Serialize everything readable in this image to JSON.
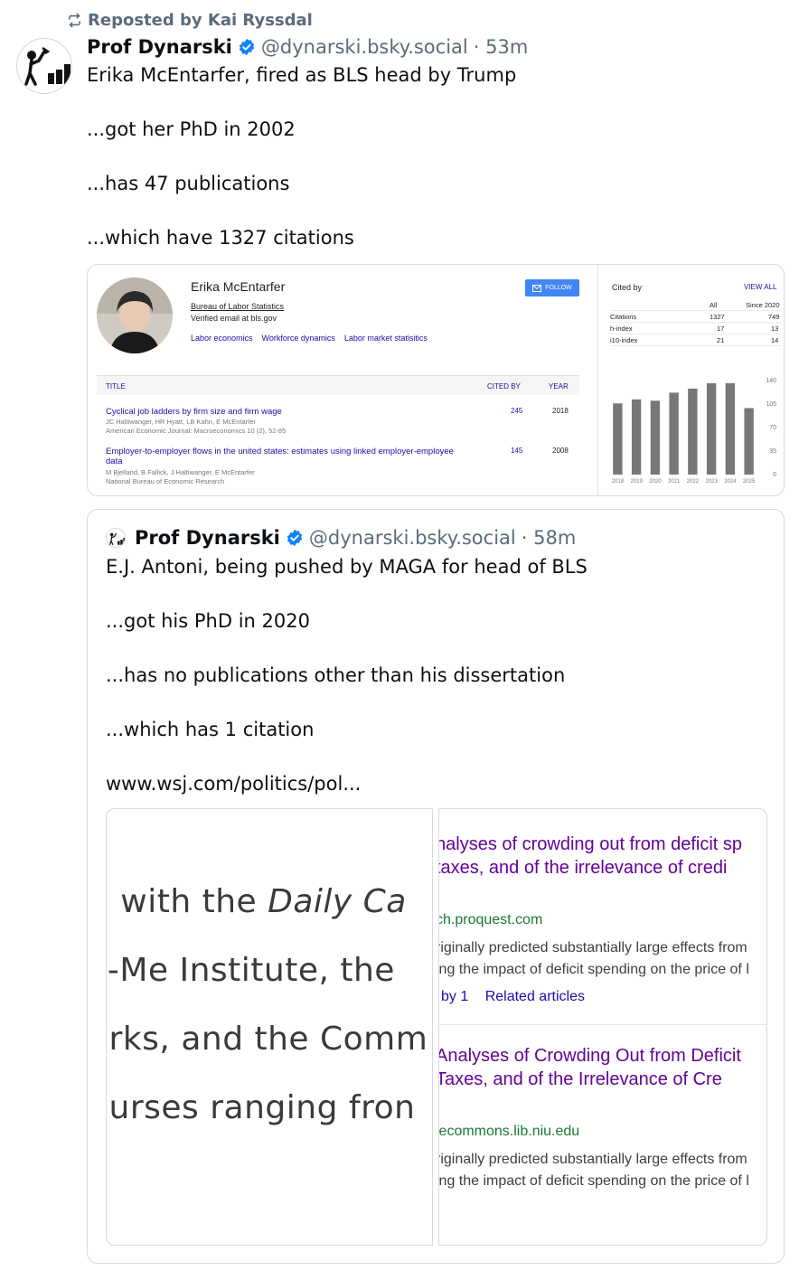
{
  "repost": {
    "label": "Reposted by Kai Ryssdal",
    "icon": "repost-icon"
  },
  "post": {
    "author_name": "Prof Dynarski",
    "handle": "@dynarski.bsky.social",
    "time": "· 53m",
    "text": "Erika McEntarfer, fired as BLS head by Trump\n\n...got her PhD in 2002\n\n...has 47 publications\n\n...which have 1327 citations"
  },
  "scholar": {
    "name": "Erika McEntarfer",
    "affiliation": "Bureau of Labor Statistics",
    "email": "Verified email at bls.gov",
    "tags": [
      "Labor economics",
      "Workforce dynamics",
      "Labor market statisitics"
    ],
    "follow": "FOLLOW",
    "headers": {
      "title": "TITLE",
      "cited_by": "CITED BY",
      "year": "YEAR"
    },
    "articles": [
      {
        "title": "Cyclical job ladders by firm size and firm wage",
        "authors": "JC Haltiwanger, HR Hyatt, LB Kahn, E McEntarfer",
        "venue": "American Economic Journal: Macroeconomics 10 (2), 52-85",
        "cited": "245",
        "year": "2018"
      },
      {
        "title": "Employer-to-employer flows in the united states: estimates using linked employer-employee data",
        "authors": "M Bjelland, B Fallick, J Haltiwanger, E McEntarfer",
        "venue": "National Bureau of Economic Research",
        "cited": "145",
        "year": "2008"
      }
    ],
    "cited_by_label": "Cited by",
    "view_all": "VIEW ALL",
    "stats_header": {
      "all": "All",
      "since": "Since 2020"
    },
    "stats": [
      {
        "label": "Citations",
        "all": "1327",
        "since": "749"
      },
      {
        "label": "h-index",
        "all": "17",
        "since": "13"
      },
      {
        "label": "i10-index",
        "all": "21",
        "since": "14"
      }
    ]
  },
  "chart_data": {
    "type": "bar",
    "categories": [
      "2018",
      "2019",
      "2020",
      "2021",
      "2022",
      "2023",
      "2024",
      "2025"
    ],
    "values": [
      106,
      112,
      110,
      122,
      128,
      136,
      136,
      99
    ],
    "yticks": [
      "140",
      "105",
      "70",
      "35",
      "0"
    ],
    "ylim": [
      0,
      140
    ],
    "bar_color": "#777777"
  },
  "quote": {
    "author_name": "Prof Dynarski",
    "handle": "@dynarski.bsky.social",
    "time": "· 58m",
    "text": "E.J. Antoni,  being pushed by MAGA for head of BLS\n\n...got his PhD in 2020\n\n...has no publications other than his dissertation\n\n...which has 1 citation\n\nwww.wsj.com/politics/pol..."
  },
  "left_image": {
    "line1a": "d with the ",
    "line1b": "Daily Ca",
    "line2": "v-Me Institute, the",
    "line3": "orks, and the Comm",
    "line4": "ourses ranging fron"
  },
  "right_image": {
    "r1_title1": "nalyses of crowding out from deficit sp",
    "r1_title2": " taxes, and of the irrelevance of credi",
    "r1_url": "ch.proquest.com",
    "r1_snip1": "riginally predicted substantially large effects from",
    "r1_snip2": "ing the impact of deficit spending on the price of l",
    "r1_cited": "by 1",
    "r1_related": "Related articles",
    "r2_title1": "Analyses of Crowding Out from Deficit",
    "r2_title2": " Taxes, and of the Irrelevance of Cre",
    "r2_url": "iecommons.lib.niu.edu",
    "r2_snip1": "riginally predicted substantially large effects from",
    "r2_snip2": "ing the impact of deficit spending on the price of l"
  }
}
